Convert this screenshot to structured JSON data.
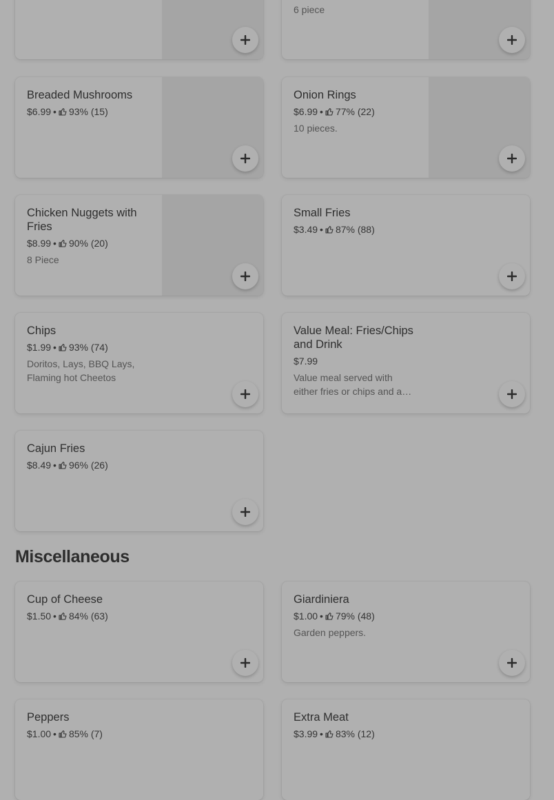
{
  "items_top": [
    {
      "name": "",
      "meta": "",
      "desc": "6 piece"
    },
    {
      "name": "",
      "meta": "",
      "desc": ""
    }
  ],
  "items": [
    {
      "name": "Breaded Mushrooms",
      "price": "$6.99",
      "rating": "93% (15)",
      "desc": ""
    },
    {
      "name": "Onion Rings",
      "price": "$6.99",
      "rating": "77% (22)",
      "desc": "10 pieces."
    },
    {
      "name": "Chicken Nuggets with Fries",
      "price": "$8.99",
      "rating": "90% (20)",
      "desc": "8 Piece"
    },
    {
      "name": "Small Fries",
      "price": "$3.49",
      "rating": "87% (88)",
      "desc": ""
    },
    {
      "name": "Chips",
      "price": "$1.99",
      "rating": "93% (74)",
      "desc": "Doritos, Lays, BBQ Lays, Flaming hot Cheetos"
    },
    {
      "name": "Value Meal: Fries/Chips and Drink",
      "price": "$7.99",
      "rating": "",
      "desc": "Value meal served with either fries or chips and a…"
    },
    {
      "name": "Cajun Fries",
      "price": "$8.49",
      "rating": "96% (26)",
      "desc": ""
    }
  ],
  "section_misc": {
    "title": "Miscellaneous"
  },
  "misc_items": [
    {
      "name": "Cup of Cheese",
      "price": "$1.50",
      "rating": "84% (63)",
      "desc": ""
    },
    {
      "name": "Giardiniera",
      "price": "$1.00",
      "rating": "79% (48)",
      "desc": "Garden peppers."
    },
    {
      "name": "Peppers",
      "price": "$1.00",
      "rating": "85% (7)",
      "desc": ""
    },
    {
      "name": "Extra Meat",
      "price": "$3.99",
      "rating": "83% (12)",
      "desc": ""
    }
  ],
  "icons": {
    "add": "plus-icon",
    "rating": "thumbs-up-icon"
  },
  "colors": {
    "overlay_bg": "#b0b0b0",
    "image_placeholder": "#a5a5a5"
  }
}
